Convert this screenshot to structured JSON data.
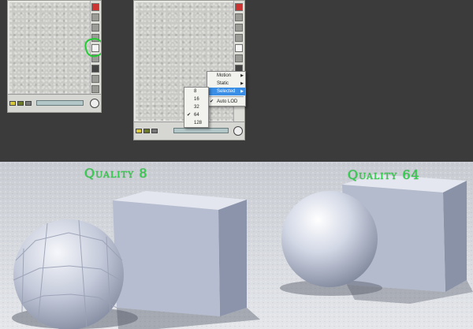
{
  "left_window": {
    "bottom_bar": {
      "mode_icons": [
        "move-icon",
        "rotate-icon",
        "scale-icon",
        "grid-icon"
      ]
    }
  },
  "right_window": {
    "status_text": "",
    "context_menu": {
      "items": [
        {
          "label": "Motion",
          "has_submenu": true
        },
        {
          "label": "Static",
          "has_submenu": true
        },
        {
          "label": "Selected",
          "has_submenu": true,
          "highlighted": true
        },
        {
          "label": "Auto LOD",
          "checked": true
        }
      ]
    },
    "submenu": {
      "items": [
        {
          "label": "8"
        },
        {
          "label": "16"
        },
        {
          "label": "32"
        },
        {
          "label": "64",
          "checked": true
        },
        {
          "label": "128"
        }
      ]
    }
  },
  "scene": {
    "left_label": "Quality 8",
    "right_label": "Quality 64",
    "label_color": "#2fd44a"
  }
}
